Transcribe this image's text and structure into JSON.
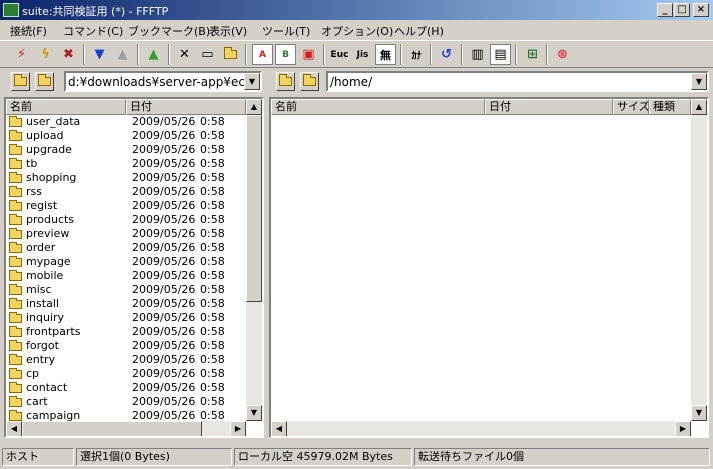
{
  "window": {
    "title": "suite:共同検証用 (*) - FFFTP"
  },
  "menu": [
    "接続(F)",
    "コマンド(C)",
    "ブックマーク(B)",
    "表示(V)",
    "ツール(T)",
    "オプション(O)",
    "ヘルプ(H)"
  ],
  "toolbar": {
    "ascii_label": "A",
    "binary_label": "B",
    "euc_label": "Euc",
    "jis_label": "Jis",
    "nochange_label": "無",
    "kana_label": "ｶﾅ"
  },
  "colors": {
    "connect_red": "#d81b1b",
    "arrow_blue": "#1a3fd6",
    "arrow_green": "#2e9e2e",
    "stop_red": "#e53935",
    "titlebar": "#0a246a"
  },
  "local": {
    "path": "d:¥downloads¥server-app¥ec",
    "headers": {
      "name": "名前",
      "date": "日付"
    },
    "files": [
      {
        "name": "user_data",
        "date": "2009/05/26",
        "time": "0:58"
      },
      {
        "name": "upload",
        "date": "2009/05/26",
        "time": "0:58"
      },
      {
        "name": "upgrade",
        "date": "2009/05/26",
        "time": "0:58"
      },
      {
        "name": "tb",
        "date": "2009/05/26",
        "time": "0:58"
      },
      {
        "name": "shopping",
        "date": "2009/05/26",
        "time": "0:58"
      },
      {
        "name": "rss",
        "date": "2009/05/26",
        "time": "0:58"
      },
      {
        "name": "regist",
        "date": "2009/05/26",
        "time": "0:58"
      },
      {
        "name": "products",
        "date": "2009/05/26",
        "time": "0:58"
      },
      {
        "name": "preview",
        "date": "2009/05/26",
        "time": "0:58"
      },
      {
        "name": "order",
        "date": "2009/05/26",
        "time": "0:58"
      },
      {
        "name": "mypage",
        "date": "2009/05/26",
        "time": "0:58"
      },
      {
        "name": "mobile",
        "date": "2009/05/26",
        "time": "0:58"
      },
      {
        "name": "misc",
        "date": "2009/05/26",
        "time": "0:58"
      },
      {
        "name": "install",
        "date": "2009/05/26",
        "time": "0:58"
      },
      {
        "name": "inquiry",
        "date": "2009/05/26",
        "time": "0:58"
      },
      {
        "name": "frontparts",
        "date": "2009/05/26",
        "time": "0:58"
      },
      {
        "name": "forgot",
        "date": "2009/05/26",
        "time": "0:58"
      },
      {
        "name": "entry",
        "date": "2009/05/26",
        "time": "0:58"
      },
      {
        "name": "cp",
        "date": "2009/05/26",
        "time": "0:58"
      },
      {
        "name": "contact",
        "date": "2009/05/26",
        "time": "0:58"
      },
      {
        "name": "cart",
        "date": "2009/05/26",
        "time": "0:58"
      },
      {
        "name": "campaign",
        "date": "2009/05/26",
        "time": "0:58"
      }
    ]
  },
  "remote": {
    "path": "/home/",
    "headers": {
      "name": "名前",
      "date": "日付",
      "size": "サイズ",
      "type": "種類"
    }
  },
  "status": {
    "host": "ホスト",
    "selected": "選択1個(0 Bytes)",
    "local_free": "ローカル空 45979.02M Bytes",
    "queue": "転送待ちファイル0個"
  }
}
